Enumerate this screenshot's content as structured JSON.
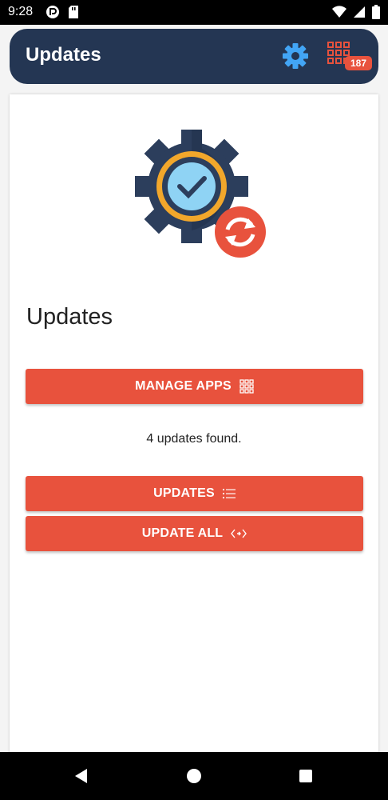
{
  "status_bar": {
    "time": "9:28"
  },
  "appbar": {
    "title": "Updates",
    "badge_count": "187"
  },
  "main": {
    "title": "Updates",
    "manage_apps_label": "MANAGE APPS",
    "found_text": "4 updates found.",
    "updates_label": "UPDATES",
    "update_all_label": "UPDATE ALL"
  },
  "colors": {
    "appbar": "#243653",
    "accent": "#e8523d",
    "settings_icon": "#42a5f5"
  },
  "icons": {
    "settings": "gear-icon",
    "apps": "apps-grid-icon",
    "manage_apps": "grid-icon",
    "updates": "list-icon",
    "update_all": "code-arrows-icon",
    "hero": "gear-check-sync-icon"
  }
}
